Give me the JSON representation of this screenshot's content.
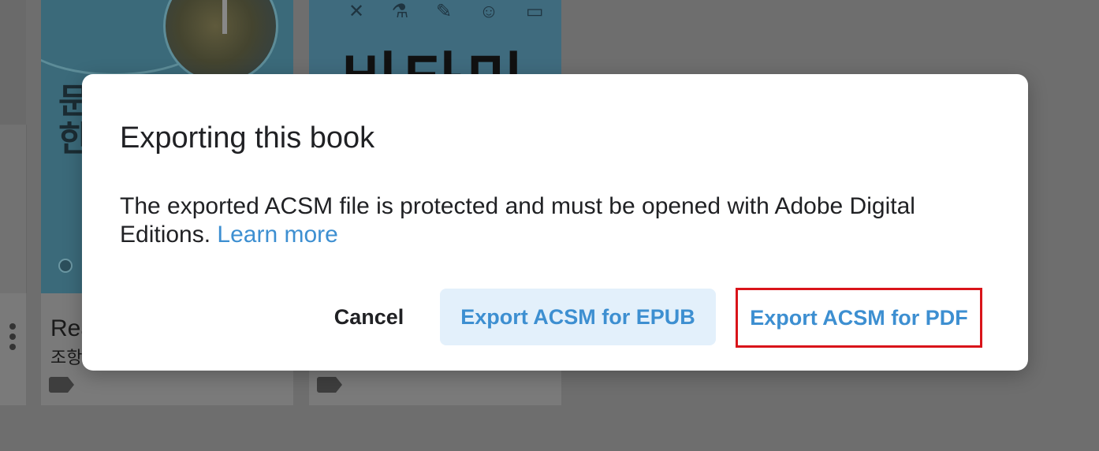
{
  "background": {
    "book_1": {
      "cover_text": "문\n한",
      "title": "Rea",
      "subtitle": "조항"
    },
    "book_2": {
      "cover_text": "비타민"
    }
  },
  "dialog": {
    "title": "Exporting this book",
    "body": "The exported ACSM file is protected and must be opened with Adobe Digital Editions.",
    "link_label": "Learn more",
    "cancel_label": "Cancel",
    "export_epub_label": "Export ACSM for EPUB",
    "export_pdf_label": "Export ACSM for PDF"
  },
  "colors": {
    "accent": "#3d8fd1",
    "epub_button_bg": "#e3f0fb",
    "highlight_border": "#d9141a",
    "overlay": "#6e6e6e"
  }
}
